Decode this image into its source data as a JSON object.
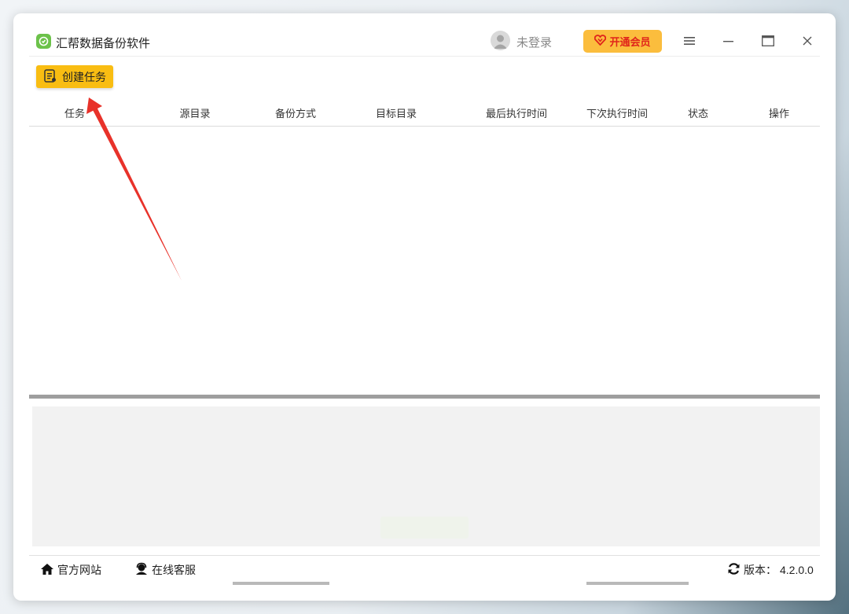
{
  "app": {
    "title": "汇帮数据备份软件",
    "login_text": "未登录",
    "vip_label": "开通会员"
  },
  "toolbar": {
    "create_task_label": "创建任务"
  },
  "table": {
    "columns": [
      "任务",
      "源目录",
      "备份方式",
      "目标目录",
      "最后执行时间",
      "下次执行时间",
      "状态",
      "操作"
    ],
    "rows": []
  },
  "footer": {
    "website_label": "官方网站",
    "support_label": "在线客服",
    "version_label": "版本：",
    "version_value": "4.2.0.0"
  },
  "colors": {
    "accent": "#f9bd12",
    "vip_bg": "#fbbd3d",
    "vip_text": "#e0241b",
    "annotation_arrow": "#e8322a",
    "logo": "#6cc24a"
  },
  "icons": [
    "app-logo-icon",
    "user-avatar-icon",
    "heart-diamond-icon",
    "menu-icon",
    "minimize-icon",
    "maximize-icon",
    "close-icon",
    "task-list-icon",
    "home-icon",
    "customer-service-icon",
    "refresh-icon"
  ]
}
